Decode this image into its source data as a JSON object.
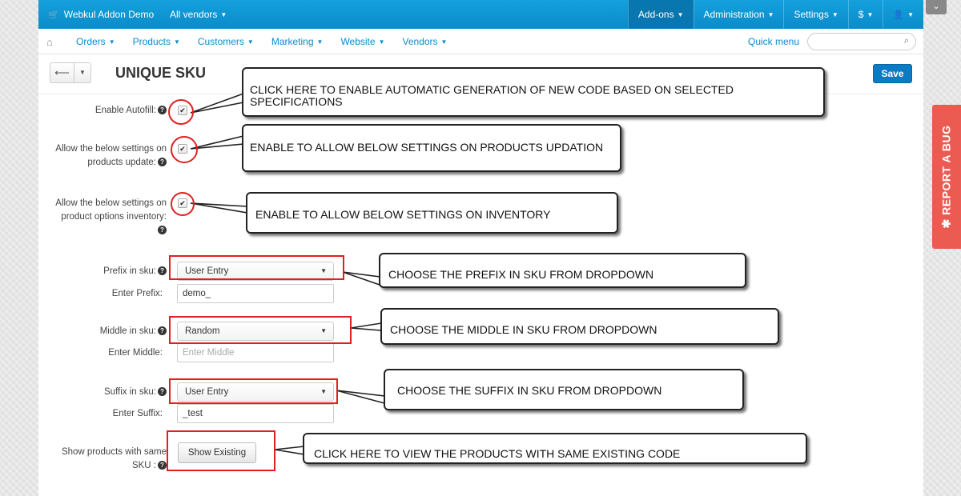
{
  "topbar": {
    "brand": "Webkul Addon Demo",
    "vendors": "All vendors",
    "menu": [
      "Add-ons",
      "Administration",
      "Settings",
      "$",
      "👤"
    ]
  },
  "subnav": {
    "items": [
      "Orders",
      "Products",
      "Customers",
      "Marketing",
      "Website",
      "Vendors"
    ],
    "quick_menu": "Quick menu"
  },
  "page": {
    "title": "UNIQUE SKU",
    "save": "Save"
  },
  "form": {
    "enable_autofill": {
      "label": "Enable Autofill:",
      "checked": true
    },
    "products_update": {
      "label_line1": "Allow the below settings on",
      "label_line2": "products update:",
      "checked": true
    },
    "options_inventory": {
      "label_line1": "Allow the below settings on",
      "label_line2": "product options inventory:",
      "checked": true
    },
    "prefix": {
      "label": "Prefix in sku:",
      "value": "User Entry",
      "enter_label": "Enter Prefix:",
      "enter_value": "demo_"
    },
    "middle": {
      "label": "Middle in sku:",
      "value": "Random",
      "enter_label": "Enter Middle:",
      "enter_placeholder": "Enter Middle"
    },
    "suffix": {
      "label": "Suffix in sku:",
      "value": "User Entry",
      "enter_label": "Enter Suffix:",
      "enter_value": "_test"
    },
    "show_same": {
      "label_line1": "Show products with same",
      "label_line2": "SKU :",
      "button": "Show Existing"
    }
  },
  "annotations": {
    "autofill": "CLICK HERE TO ENABLE AUTOMATIC GENERATION OF NEW CODE BASED ON SELECTED SPECIFICATIONS",
    "update": "ENABLE TO ALLOW BELOW SETTINGS ON PRODUCTS UPDATION",
    "inventory": "ENABLE TO ALLOW BELOW SETTINGS ON INVENTORY",
    "prefix": "CHOOSE THE PREFIX IN SKU FROM DROPDOWN",
    "middle": "CHOOSE THE MIDDLE IN SKU FROM DROPDOWN",
    "suffix": "CHOOSE THE SUFFIX IN SKU FROM DROPDOWN",
    "existing": "CLICK HERE TO VIEW THE PRODUCTS WITH SAME EXISTING CODE"
  },
  "sidebar_tab": {
    "label": "REPORT A BUG",
    "icon": "bug-icon",
    "color": "#ec5b52"
  },
  "colors": {
    "topbar": "#0b8cc9",
    "save": "#0b7cc3",
    "highlight": "#e02020"
  }
}
